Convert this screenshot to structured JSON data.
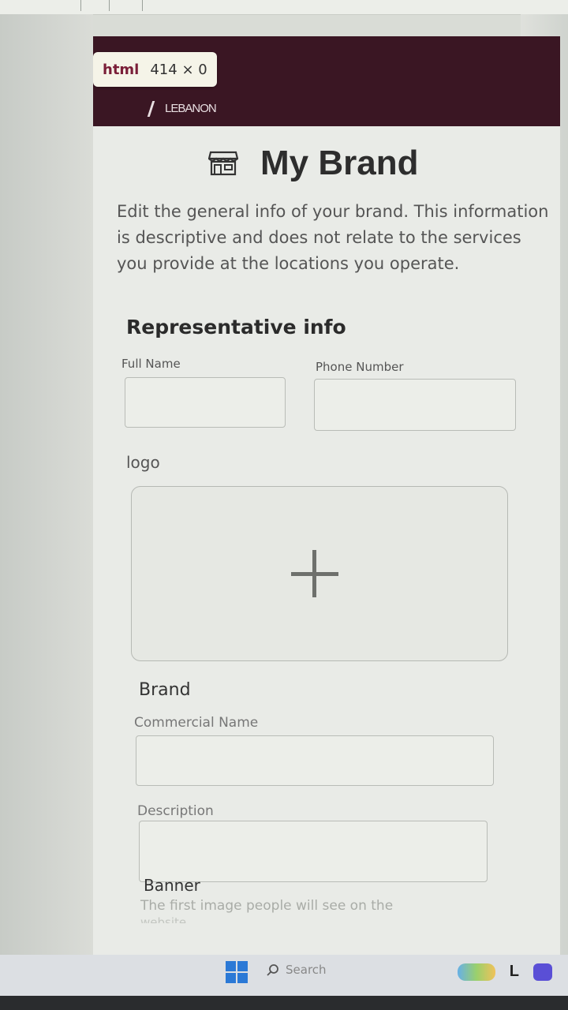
{
  "devtools": {
    "tag": "html",
    "size": "414 × 0"
  },
  "header": {
    "logo_text": "LEBANON"
  },
  "page": {
    "title": "My Brand",
    "intro": "Edit the general info of your brand. This information is descriptive and does not relate to the services you provide at the locations you operate."
  },
  "representative": {
    "title": "Representative info",
    "full_name_label": "Full Name",
    "full_name_value": "",
    "phone_label": "Phone Number",
    "phone_value": ""
  },
  "logo": {
    "label": "logo",
    "add_icon": "plus-icon"
  },
  "brand": {
    "title": "Brand",
    "commercial_name_label": "Commercial Name",
    "commercial_name_value": "",
    "description_label": "Description",
    "description_value": ""
  },
  "banner": {
    "title": "Banner",
    "subtitle": "The first image people will see on the",
    "subtitle_2": "website"
  },
  "taskbar": {
    "search_label": "Search",
    "icons": [
      "windows-start-icon",
      "search-icon",
      "widgets-icon",
      "app-icon",
      "chat-icon"
    ]
  },
  "colors": {
    "header_bg": "#3a1623",
    "accent_windows": "#2b79d6"
  }
}
